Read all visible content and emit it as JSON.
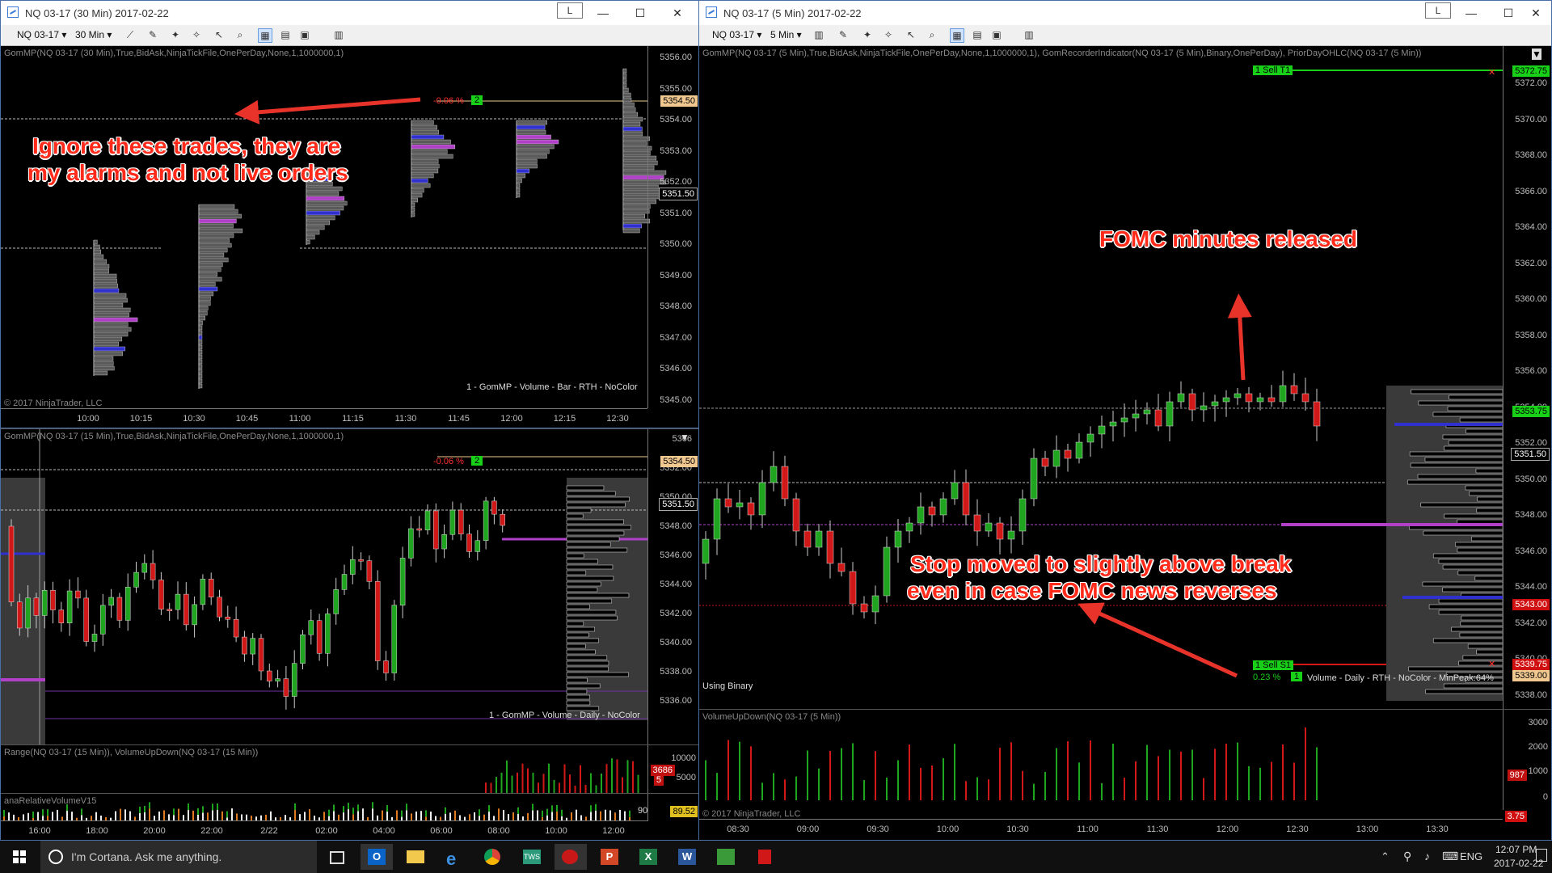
{
  "left_top": {
    "title": "NQ 03-17 (30 Min)  2017-02-22",
    "layout_btn": "L",
    "instrument": "NQ 03-17",
    "interval": "30 Min",
    "indicator_title": "GomMP(NQ 03-17 (30 Min),True,BidAsk,NinjaTickFile,OnePerDay,None,1,1000000,1)",
    "copyright": "© 2017 NinjaTrader, LLC",
    "profile_label": "1 - GomMP  - Volume - Bar - RTH - NoColor",
    "pct_label": "-0.06 %",
    "qty_label": "2",
    "price_badges": [
      "5354.50",
      "5351.50"
    ],
    "y_ticks": [
      "5356.00",
      "5355.00",
      "5354.00",
      "5353.00",
      "5352.00",
      "5351.00",
      "5350.00",
      "5349.00",
      "5348.00",
      "5347.00",
      "5346.00",
      "5345.00"
    ],
    "x_ticks": [
      "10:00",
      "10:15",
      "10:30",
      "10:45",
      "11:00",
      "11:15",
      "11:30",
      "11:45",
      "12:00",
      "12:15",
      "12:30"
    ]
  },
  "left_bottom": {
    "indicator_title": "GomMP(NQ 03-17 (15 Min),True,BidAsk,NinjaTickFile,OnePerDay,None,1,1000000,1)",
    "profile_label": "1 - GomMP  - Volume - Daily - NoColor",
    "pct_label": "-0.06 %",
    "qty_label": "2",
    "price_badges": [
      "5354.50",
      "5351.50"
    ],
    "y_ticks": [
      "5366",
      "5352.00",
      "5350.00",
      "5348.00",
      "5346.00",
      "5344.00",
      "5342.00",
      "5340.00",
      "5338.00",
      "5336.00"
    ],
    "range_title": "Range(NQ 03-17 (15 Min)), VolumeUpDown(NQ 03-17 (15 Min))",
    "range_ticks": [
      "10000",
      "5000"
    ],
    "range_badges": [
      "3686",
      "5"
    ],
    "rel_title": "anaRelativeVolumeV15",
    "rel_badges": [
      "90",
      "89.52"
    ],
    "x_ticks": [
      "16:00",
      "18:00",
      "20:00",
      "22:00",
      "2/22",
      "02:00",
      "04:00",
      "06:00",
      "08:00",
      "10:00",
      "12:00"
    ]
  },
  "right": {
    "title": "NQ 03-17 (5 Min)  2017-02-22",
    "layout_btn": "L",
    "instrument": "NQ 03-17",
    "interval": "5 Min",
    "indicator_title": "GomMP(NQ 03-17 (5 Min),True,BidAsk,NinjaTickFile,OnePerDay,None,1,1000000,1), GomRecorderIndicator(NQ 03-17 (5 Min),Binary,OnePerDay), PriorDayOHLC(NQ 03-17 (5 Min))",
    "using_binary": "Using Binary",
    "profile_label": "Volume - Daily - RTH - NoColor - MinPeak:64%",
    "sell_t1": "1  Sell T1",
    "sell_s1": "1  Sell S1",
    "pct_label": "0.23 %",
    "qty_label": "1",
    "price_badges": [
      "5372.75",
      "5353.75",
      "5351.50",
      "5343.00",
      "5339.75",
      "5339.00"
    ],
    "y_ticks": [
      "5372.00",
      "5370.00",
      "5368.00",
      "5366.00",
      "5364.00",
      "5362.00",
      "5360.00",
      "5358.00",
      "5356.00",
      "5354.00",
      "5352.00",
      "5350.00",
      "5348.00",
      "5346.00",
      "5344.00",
      "5342.00",
      "5340.00",
      "5338.00"
    ],
    "vol_title": "VolumeUpDown(NQ 03-17 (5 Min))",
    "vol_ticks": [
      "3000",
      "2000",
      "1000",
      "0"
    ],
    "vol_badge": "987",
    "bottom_badge": "3.75",
    "copyright": "© 2017 NinjaTrader, LLC",
    "x_ticks": [
      "08:30",
      "09:00",
      "09:30",
      "10:00",
      "10:30",
      "11:00",
      "11:30",
      "12:00",
      "12:30",
      "13:00",
      "13:30"
    ]
  },
  "annotations": {
    "ignore_line1": "Ignore these trades, they are",
    "ignore_line2": "my alarms and not live orders",
    "fomc": "FOMC minutes released",
    "stop_line1": "Stop moved to slightly above break",
    "stop_line2": "even in case FOMC news reverses"
  },
  "taskbar": {
    "cortana": "I'm Cortana. Ask me anything.",
    "lang": "ENG",
    "time": "12:07 PM",
    "date": "2017-02-22"
  },
  "window_buttons": {
    "minimize": "—",
    "maximize": "☐",
    "close": "✕"
  },
  "colors": {
    "up": "#1fa51f",
    "down": "#d01818",
    "poc": "#b040c8",
    "va": "#3030d0",
    "accent_arrow": "#e8332a"
  }
}
